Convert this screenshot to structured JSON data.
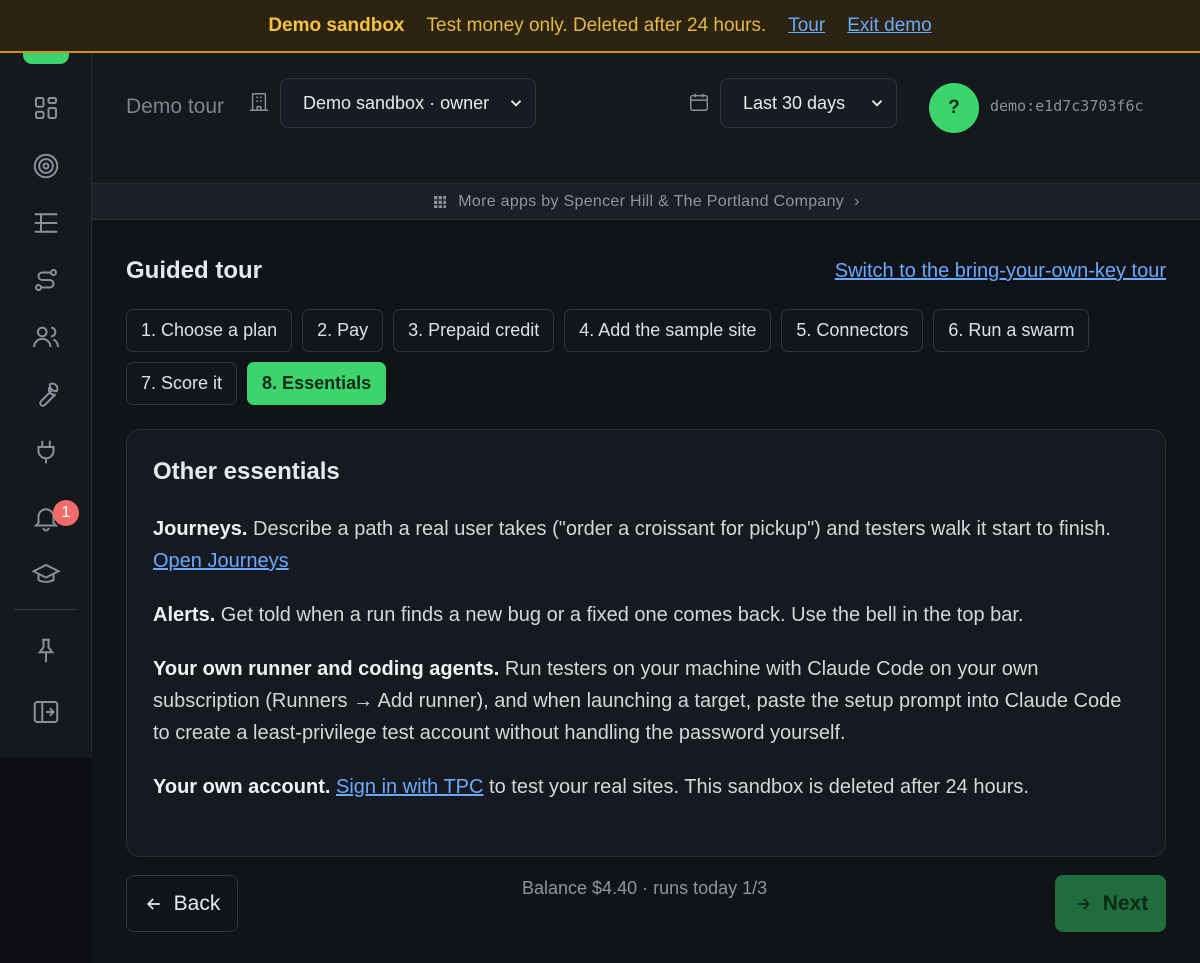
{
  "banner": {
    "title": "Demo sandbox",
    "message": "Test money only. Deleted after 24 hours.",
    "tour_link": "Tour",
    "exit_link": "Exit demo"
  },
  "sidebar": {
    "notification_count": "1",
    "items": [
      {
        "icon": "dashboard-icon"
      },
      {
        "icon": "target-icon"
      },
      {
        "icon": "tree-list-icon"
      },
      {
        "icon": "route-icon"
      },
      {
        "icon": "users-icon"
      },
      {
        "icon": "wrench-icon"
      },
      {
        "icon": "plug-icon"
      },
      {
        "icon": "bell-icon"
      },
      {
        "icon": "graduation-cap-icon"
      },
      {
        "icon": "pin-icon"
      },
      {
        "icon": "exit-panel-icon"
      }
    ]
  },
  "topbar": {
    "page_label": "Demo tour",
    "workspace_select": "Demo sandbox · owner",
    "range_select": "Last 30 days",
    "avatar_initial": "?",
    "user_id": "demo:e1d7c3703f6c"
  },
  "more_apps": {
    "text": "More apps by Spencer Hill & The Portland Company",
    "chevron": "›"
  },
  "tour": {
    "title": "Guided tour",
    "switch_link": "Switch to the bring-your-own-key tour",
    "steps": [
      "1. Choose a plan",
      "2. Pay",
      "3. Prepaid credit",
      "4. Add the sample site",
      "5. Connectors",
      "6. Run a swarm",
      "7. Score it",
      "8. Essentials"
    ],
    "active_step": "8. Essentials"
  },
  "card": {
    "title": "Other essentials",
    "journeys": {
      "heading": "Journeys.",
      "text": " Describe a path a real user takes (\"order a croissant for pickup\") and testers walk it start to finish. ",
      "link": "Open Journeys"
    },
    "alerts": {
      "heading": "Alerts.",
      "text": " Get told when a run finds a new bug or a fixed one comes back. Use the bell in the top bar."
    },
    "runner": {
      "heading": "Your own runner and coding agents.",
      "text": " Run testers on your machine with Claude Code on your own subscription (Runners → Add runner), and when launching a target, paste the setup prompt into Claude Code to create a least-privilege test account without handling the password yourself."
    },
    "account": {
      "heading": "Your own account.",
      "link": "Sign in with TPC",
      "text": " to test your real sites. This sandbox is deleted after 24 hours."
    }
  },
  "footer": {
    "back_label": "Back",
    "balance_text": "Balance $4.40 · runs today 1/3",
    "next_label": "Next"
  },
  "colors": {
    "accent_green": "#3dd46d",
    "banner_bg": "#2c2410",
    "banner_text": "#e2b944",
    "link_blue": "#6aa9ff",
    "badge_red": "#f26b6b"
  }
}
